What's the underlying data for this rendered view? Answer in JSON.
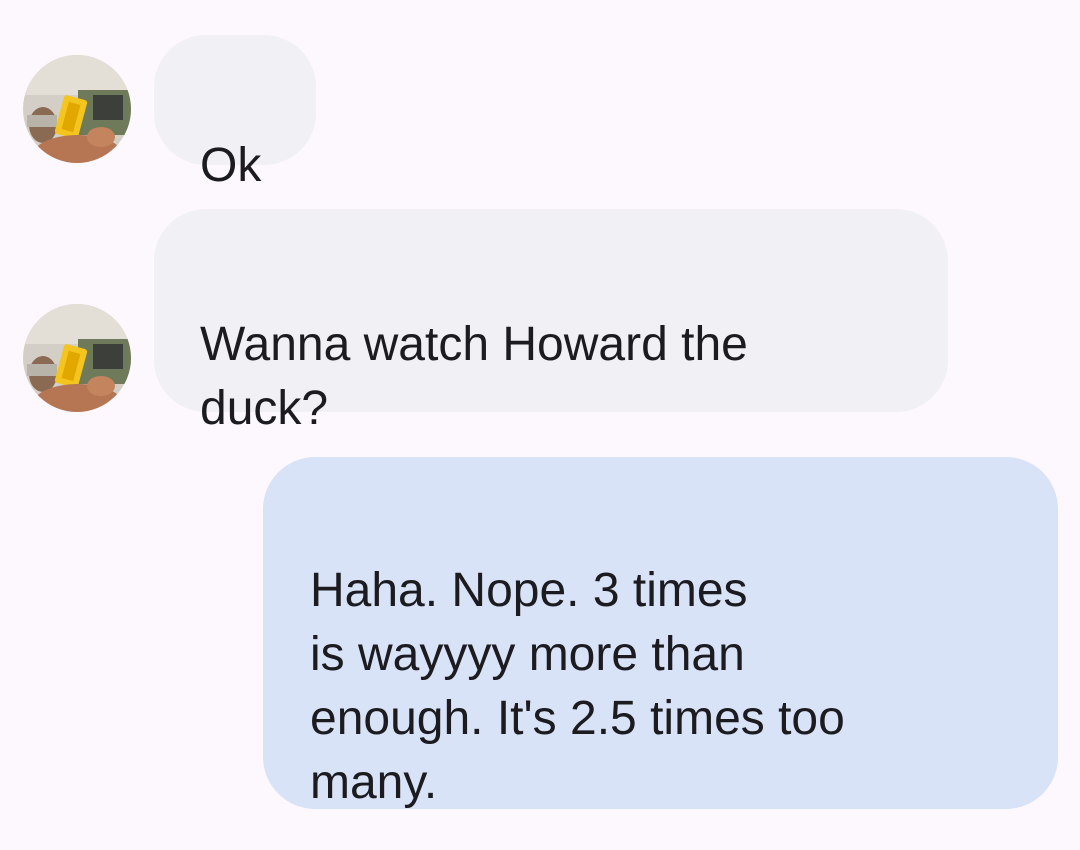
{
  "conversation": {
    "messages": [
      {
        "direction": "incoming",
        "text": "Ok"
      },
      {
        "direction": "incoming",
        "text": "Wanna watch Howard the\nduck?"
      },
      {
        "direction": "outgoing",
        "text": "Haha. Nope. 3 times\nis wayyyy more than\nenough. It's 2.5 times too\nmany."
      }
    ]
  },
  "colors": {
    "background": "#fdf8fd",
    "incoming_bubble": "#f1f0f5",
    "outgoing_bubble": "#d8e3f8",
    "text": "#1c1b1f"
  }
}
